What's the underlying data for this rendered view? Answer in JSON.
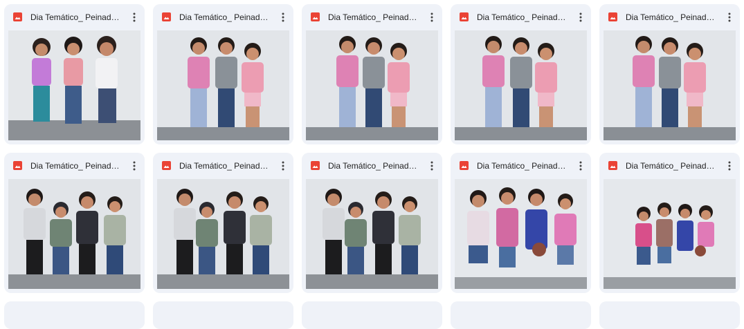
{
  "files": [
    {
      "name": "Dia Temático_ Peinados..."
    },
    {
      "name": "Dia Temático_ Peinados..."
    },
    {
      "name": "Dia Temático_ Peinados..."
    },
    {
      "name": "Dia Temático_ Peinados..."
    },
    {
      "name": "Dia Temático_ Peinados..."
    },
    {
      "name": "Dia Temático_ Peinados..."
    },
    {
      "name": "Dia Temático_ Peinados..."
    },
    {
      "name": "Dia Temático_ Peinados..."
    },
    {
      "name": "Dia Temático_ Peinados..."
    },
    {
      "name": "Dia Temático_ Peinados..."
    }
  ],
  "icons": {
    "file_type": "image-file-icon",
    "more": "more-vert-icon"
  },
  "colors": {
    "card_bg": "#eff2f8",
    "image_icon": "#ea4335",
    "text": "#1f1f1f"
  }
}
